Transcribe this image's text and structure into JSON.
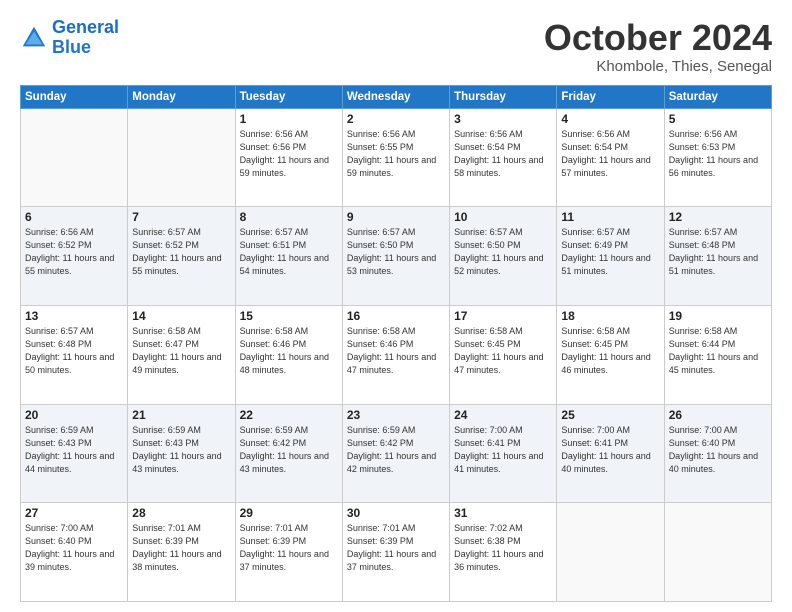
{
  "logo": {
    "line1": "General",
    "line2": "Blue"
  },
  "title": "October 2024",
  "location": "Khombole, Thies, Senegal",
  "weekdays": [
    "Sunday",
    "Monday",
    "Tuesday",
    "Wednesday",
    "Thursday",
    "Friday",
    "Saturday"
  ],
  "weeks": [
    [
      {
        "day": "",
        "sunrise": "",
        "sunset": "",
        "daylight": ""
      },
      {
        "day": "",
        "sunrise": "",
        "sunset": "",
        "daylight": ""
      },
      {
        "day": "1",
        "sunrise": "Sunrise: 6:56 AM",
        "sunset": "Sunset: 6:56 PM",
        "daylight": "Daylight: 11 hours and 59 minutes."
      },
      {
        "day": "2",
        "sunrise": "Sunrise: 6:56 AM",
        "sunset": "Sunset: 6:55 PM",
        "daylight": "Daylight: 11 hours and 59 minutes."
      },
      {
        "day": "3",
        "sunrise": "Sunrise: 6:56 AM",
        "sunset": "Sunset: 6:54 PM",
        "daylight": "Daylight: 11 hours and 58 minutes."
      },
      {
        "day": "4",
        "sunrise": "Sunrise: 6:56 AM",
        "sunset": "Sunset: 6:54 PM",
        "daylight": "Daylight: 11 hours and 57 minutes."
      },
      {
        "day": "5",
        "sunrise": "Sunrise: 6:56 AM",
        "sunset": "Sunset: 6:53 PM",
        "daylight": "Daylight: 11 hours and 56 minutes."
      }
    ],
    [
      {
        "day": "6",
        "sunrise": "Sunrise: 6:56 AM",
        "sunset": "Sunset: 6:52 PM",
        "daylight": "Daylight: 11 hours and 55 minutes."
      },
      {
        "day": "7",
        "sunrise": "Sunrise: 6:57 AM",
        "sunset": "Sunset: 6:52 PM",
        "daylight": "Daylight: 11 hours and 55 minutes."
      },
      {
        "day": "8",
        "sunrise": "Sunrise: 6:57 AM",
        "sunset": "Sunset: 6:51 PM",
        "daylight": "Daylight: 11 hours and 54 minutes."
      },
      {
        "day": "9",
        "sunrise": "Sunrise: 6:57 AM",
        "sunset": "Sunset: 6:50 PM",
        "daylight": "Daylight: 11 hours and 53 minutes."
      },
      {
        "day": "10",
        "sunrise": "Sunrise: 6:57 AM",
        "sunset": "Sunset: 6:50 PM",
        "daylight": "Daylight: 11 hours and 52 minutes."
      },
      {
        "day": "11",
        "sunrise": "Sunrise: 6:57 AM",
        "sunset": "Sunset: 6:49 PM",
        "daylight": "Daylight: 11 hours and 51 minutes."
      },
      {
        "day": "12",
        "sunrise": "Sunrise: 6:57 AM",
        "sunset": "Sunset: 6:48 PM",
        "daylight": "Daylight: 11 hours and 51 minutes."
      }
    ],
    [
      {
        "day": "13",
        "sunrise": "Sunrise: 6:57 AM",
        "sunset": "Sunset: 6:48 PM",
        "daylight": "Daylight: 11 hours and 50 minutes."
      },
      {
        "day": "14",
        "sunrise": "Sunrise: 6:58 AM",
        "sunset": "Sunset: 6:47 PM",
        "daylight": "Daylight: 11 hours and 49 minutes."
      },
      {
        "day": "15",
        "sunrise": "Sunrise: 6:58 AM",
        "sunset": "Sunset: 6:46 PM",
        "daylight": "Daylight: 11 hours and 48 minutes."
      },
      {
        "day": "16",
        "sunrise": "Sunrise: 6:58 AM",
        "sunset": "Sunset: 6:46 PM",
        "daylight": "Daylight: 11 hours and 47 minutes."
      },
      {
        "day": "17",
        "sunrise": "Sunrise: 6:58 AM",
        "sunset": "Sunset: 6:45 PM",
        "daylight": "Daylight: 11 hours and 47 minutes."
      },
      {
        "day": "18",
        "sunrise": "Sunrise: 6:58 AM",
        "sunset": "Sunset: 6:45 PM",
        "daylight": "Daylight: 11 hours and 46 minutes."
      },
      {
        "day": "19",
        "sunrise": "Sunrise: 6:58 AM",
        "sunset": "Sunset: 6:44 PM",
        "daylight": "Daylight: 11 hours and 45 minutes."
      }
    ],
    [
      {
        "day": "20",
        "sunrise": "Sunrise: 6:59 AM",
        "sunset": "Sunset: 6:43 PM",
        "daylight": "Daylight: 11 hours and 44 minutes."
      },
      {
        "day": "21",
        "sunrise": "Sunrise: 6:59 AM",
        "sunset": "Sunset: 6:43 PM",
        "daylight": "Daylight: 11 hours and 43 minutes."
      },
      {
        "day": "22",
        "sunrise": "Sunrise: 6:59 AM",
        "sunset": "Sunset: 6:42 PM",
        "daylight": "Daylight: 11 hours and 43 minutes."
      },
      {
        "day": "23",
        "sunrise": "Sunrise: 6:59 AM",
        "sunset": "Sunset: 6:42 PM",
        "daylight": "Daylight: 11 hours and 42 minutes."
      },
      {
        "day": "24",
        "sunrise": "Sunrise: 7:00 AM",
        "sunset": "Sunset: 6:41 PM",
        "daylight": "Daylight: 11 hours and 41 minutes."
      },
      {
        "day": "25",
        "sunrise": "Sunrise: 7:00 AM",
        "sunset": "Sunset: 6:41 PM",
        "daylight": "Daylight: 11 hours and 40 minutes."
      },
      {
        "day": "26",
        "sunrise": "Sunrise: 7:00 AM",
        "sunset": "Sunset: 6:40 PM",
        "daylight": "Daylight: 11 hours and 40 minutes."
      }
    ],
    [
      {
        "day": "27",
        "sunrise": "Sunrise: 7:00 AM",
        "sunset": "Sunset: 6:40 PM",
        "daylight": "Daylight: 11 hours and 39 minutes."
      },
      {
        "day": "28",
        "sunrise": "Sunrise: 7:01 AM",
        "sunset": "Sunset: 6:39 PM",
        "daylight": "Daylight: 11 hours and 38 minutes."
      },
      {
        "day": "29",
        "sunrise": "Sunrise: 7:01 AM",
        "sunset": "Sunset: 6:39 PM",
        "daylight": "Daylight: 11 hours and 37 minutes."
      },
      {
        "day": "30",
        "sunrise": "Sunrise: 7:01 AM",
        "sunset": "Sunset: 6:39 PM",
        "daylight": "Daylight: 11 hours and 37 minutes."
      },
      {
        "day": "31",
        "sunrise": "Sunrise: 7:02 AM",
        "sunset": "Sunset: 6:38 PM",
        "daylight": "Daylight: 11 hours and 36 minutes."
      },
      {
        "day": "",
        "sunrise": "",
        "sunset": "",
        "daylight": ""
      },
      {
        "day": "",
        "sunrise": "",
        "sunset": "",
        "daylight": ""
      }
    ]
  ]
}
